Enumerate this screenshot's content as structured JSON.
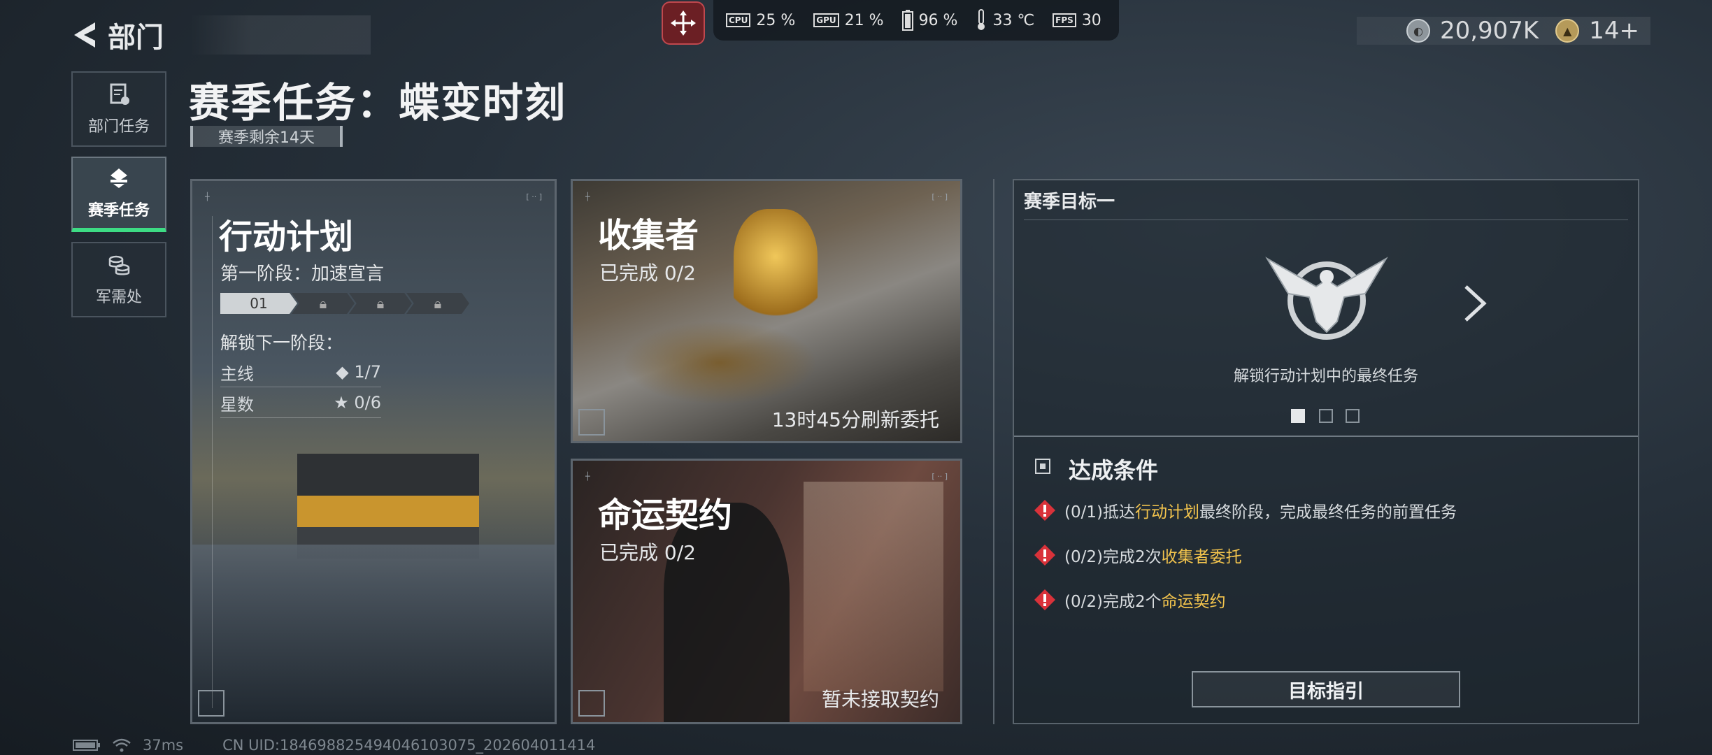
{
  "header": {
    "back_title": "部门",
    "page_title": "赛季任务：蝶变时刻",
    "season_remaining": "赛季剩余14天"
  },
  "perf": {
    "cpu_label": "CPU",
    "cpu": "25 %",
    "gpu_label": "GPU",
    "gpu": "21 %",
    "battery": "96 %",
    "temp": "33 ℃",
    "fps_label": "FPS",
    "fps": "30"
  },
  "currency": {
    "amount": "20,907K",
    "level": "14+"
  },
  "sidebar": {
    "items": [
      {
        "label": "部门任务",
        "icon": "clipboard-icon"
      },
      {
        "label": "赛季任务",
        "icon": "butterfly-icon"
      },
      {
        "label": "军需处",
        "icon": "coins-icon"
      }
    ]
  },
  "cards": {
    "action_plan": {
      "title": "行动计划",
      "stage": "第一阶段：加速宣言",
      "stage_first": "01",
      "unlock_label": "解锁下一阶段：",
      "mainline_label": "主线",
      "mainline_value": "1/7",
      "stars_label": "星数",
      "stars_value": "0/6"
    },
    "collector": {
      "title": "收集者",
      "progress": "已完成 0/2",
      "refresh": "13时45分刷新委托"
    },
    "fate_contract": {
      "title": "命运契约",
      "progress": "已完成 0/2",
      "status": "暂未接取契约"
    }
  },
  "goal": {
    "header": "赛季目标一",
    "description": "解锁行动计划中的最终任务",
    "conditions_title": "达成条件",
    "conditions": [
      {
        "prefix": "(0/1)抵达",
        "highlight": "行动计划",
        "suffix": "最终阶段，完成最终任务的前置任务"
      },
      {
        "prefix": "(0/2)完成2次",
        "highlight": "收集者委托",
        "suffix": ""
      },
      {
        "prefix": "(0/2)完成2个",
        "highlight": "命运契约",
        "suffix": ""
      }
    ],
    "guide_button": "目标指引"
  },
  "footer": {
    "ping": "37ms",
    "uid": "CN UID:1846988254940461030​75_202604011414"
  },
  "colors": {
    "accent_green": "#3ddc84",
    "highlight_yellow": "#f3c44d",
    "warn_red": "#d9323a"
  }
}
